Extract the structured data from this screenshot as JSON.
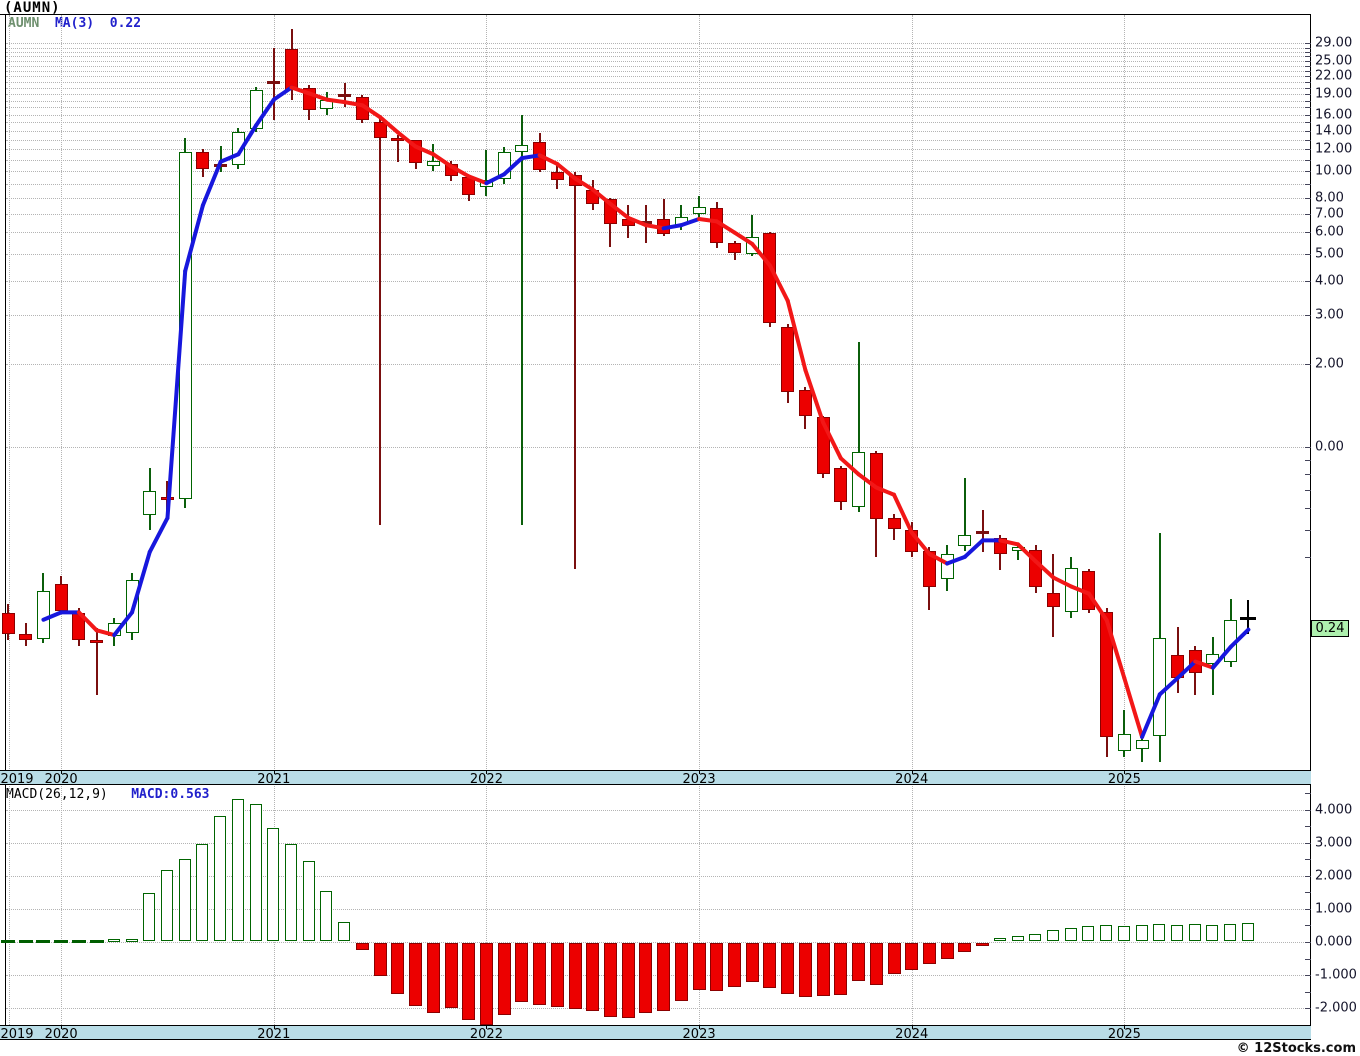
{
  "chart": {
    "title": "(AUMN)",
    "legend": {
      "symbol": "AUMN",
      "ma": "MA(3)",
      "ma_value": "0.22"
    },
    "macd_legend": {
      "label": "MACD(26,12,9)",
      "value": "MACD:0.563"
    },
    "watermark": "© 12Stocks.com",
    "badge": "0.24",
    "x_years": [
      "2019",
      "2020",
      "2021",
      "2022",
      "2023",
      "2024",
      "2025"
    ]
  },
  "colors": {
    "up": "#006400",
    "down_fill": "#ec0000",
    "down_border": "#8b0000",
    "wick_down": "#7a0f0f",
    "wick_up": "#0b5e0b",
    "neutral": "#7a0f0f",
    "ma_up": "#1717dd",
    "ma_down": "#f21717",
    "last": "#000000",
    "band": "#b9dde7",
    "badge_bg": "#aef0ae",
    "grid": "#b4b4b4"
  },
  "chart_data": {
    "type": "candlestick",
    "symbol": "AUMN",
    "interval": "monthly",
    "price_scale": "log",
    "title": "(AUMN)",
    "legend_position": "top-left",
    "grid": true,
    "overlay": {
      "type": "moving_average",
      "period": 3,
      "last_value": 0.22,
      "up_color": "blue",
      "down_color": "red"
    },
    "price_axis_labels": [
      {
        "value": 29,
        "text": "29.00"
      },
      {
        "value": 25,
        "text": "25.00"
      },
      {
        "value": 22,
        "text": "22.00"
      },
      {
        "value": 19,
        "text": "19.00"
      },
      {
        "value": 16,
        "text": "16.00"
      },
      {
        "value": 14,
        "text": "14.00"
      },
      {
        "value": 12,
        "text": "12.00"
      },
      {
        "value": 10,
        "text": "10.00"
      },
      {
        "value": 8,
        "text": "8.00"
      },
      {
        "value": 7,
        "text": "7.00"
      },
      {
        "value": 6,
        "text": "6.00"
      },
      {
        "value": 5,
        "text": "5.00"
      },
      {
        "value": 4,
        "text": "4.00"
      },
      {
        "value": 3,
        "text": "3.00"
      },
      {
        "value": 2,
        "text": "2.00"
      },
      {
        "value": 1,
        "text": "0.00"
      }
    ],
    "last_close": 0.24,
    "candles": [
      {
        "t": "2019-10",
        "o": 0.25,
        "h": 0.27,
        "l": 0.2,
        "c": 0.21
      },
      {
        "t": "2019-11",
        "o": 0.21,
        "h": 0.23,
        "l": 0.19,
        "c": 0.2
      },
      {
        "t": "2019-12",
        "o": 0.2,
        "h": 0.35,
        "l": 0.195,
        "c": 0.3
      },
      {
        "t": "2020-01",
        "o": 0.32,
        "h": 0.34,
        "l": 0.25,
        "c": 0.255
      },
      {
        "t": "2020-02",
        "o": 0.25,
        "h": 0.26,
        "l": 0.19,
        "c": 0.2
      },
      {
        "t": "2020-03",
        "o": 0.2,
        "h": 0.22,
        "l": 0.126,
        "c": 0.195
      },
      {
        "t": "2020-04",
        "o": 0.205,
        "h": 0.24,
        "l": 0.19,
        "c": 0.23
      },
      {
        "t": "2020-05",
        "o": 0.21,
        "h": 0.35,
        "l": 0.2,
        "c": 0.33
      },
      {
        "t": "2020-06",
        "o": 0.56,
        "h": 0.84,
        "l": 0.5,
        "c": 0.69
      },
      {
        "t": "2020-07",
        "o": 0.66,
        "h": 0.75,
        "l": 0.58,
        "c": 0.64
      },
      {
        "t": "2020-08",
        "o": 0.64,
        "h": 13.2,
        "l": 0.6,
        "c": 11.7
      },
      {
        "t": "2020-09",
        "o": 11.7,
        "h": 12.0,
        "l": 9.5,
        "c": 10.2
      },
      {
        "t": "2020-10",
        "o": 10.4,
        "h": 12.3,
        "l": 9.9,
        "c": 10.5
      },
      {
        "t": "2020-11",
        "o": 10.4,
        "h": 14.3,
        "l": 10.2,
        "c": 13.8
      },
      {
        "t": "2020-12",
        "o": 14.1,
        "h": 20.1,
        "l": 13.9,
        "c": 19.6
      },
      {
        "t": "2021-01",
        "o": 21.0,
        "h": 27.9,
        "l": 15.3,
        "c": 21.0
      },
      {
        "t": "2021-02",
        "o": 27.7,
        "h": 32.6,
        "l": 18.1,
        "c": 19.6
      },
      {
        "t": "2021-03",
        "o": 20.0,
        "h": 20.5,
        "l": 15.3,
        "c": 16.7
      },
      {
        "t": "2021-04",
        "o": 16.6,
        "h": 19.3,
        "l": 16.0,
        "c": 18.1
      },
      {
        "t": "2021-05",
        "o": 18.7,
        "h": 20.9,
        "l": 17.0,
        "c": 18.5
      },
      {
        "t": "2021-06",
        "o": 18.5,
        "h": 18.8,
        "l": 14.9,
        "c": 15.3
      },
      {
        "t": "2021-07",
        "o": 15.0,
        "h": 15.5,
        "l": 0.52,
        "c": 13.2
      },
      {
        "t": "2021-08",
        "o": 13.2,
        "h": 13.5,
        "l": 10.8,
        "c": 12.9
      },
      {
        "t": "2021-09",
        "o": 12.9,
        "h": 13.0,
        "l": 10.2,
        "c": 10.7
      },
      {
        "t": "2021-10",
        "o": 10.3,
        "h": 12.5,
        "l": 10.0,
        "c": 10.9
      },
      {
        "t": "2021-11",
        "o": 10.6,
        "h": 10.9,
        "l": 9.2,
        "c": 9.6
      },
      {
        "t": "2021-12",
        "o": 9.5,
        "h": 9.7,
        "l": 7.8,
        "c": 8.2
      },
      {
        "t": "2022-01",
        "o": 8.7,
        "h": 11.9,
        "l": 8.1,
        "c": 9.3
      },
      {
        "t": "2022-02",
        "o": 9.3,
        "h": 12.2,
        "l": 9.0,
        "c": 11.7
      },
      {
        "t": "2022-03",
        "o": 11.6,
        "h": 15.9,
        "l": 0.52,
        "c": 12.4
      },
      {
        "t": "2022-04",
        "o": 12.7,
        "h": 13.7,
        "l": 9.9,
        "c": 10.1
      },
      {
        "t": "2022-05",
        "o": 9.9,
        "h": 10.5,
        "l": 8.6,
        "c": 9.3
      },
      {
        "t": "2022-06",
        "o": 9.7,
        "h": 9.9,
        "l": 0.36,
        "c": 8.8
      },
      {
        "t": "2022-07",
        "o": 8.5,
        "h": 9.3,
        "l": 7.2,
        "c": 7.6
      },
      {
        "t": "2022-08",
        "o": 7.9,
        "h": 8.0,
        "l": 5.3,
        "c": 6.4
      },
      {
        "t": "2022-09",
        "o": 6.7,
        "h": 7.5,
        "l": 5.7,
        "c": 6.3
      },
      {
        "t": "2022-10",
        "o": 6.5,
        "h": 7.5,
        "l": 5.5,
        "c": 6.4
      },
      {
        "t": "2022-11",
        "o": 6.7,
        "h": 7.9,
        "l": 5.8,
        "c": 5.9
      },
      {
        "t": "2022-12",
        "o": 6.3,
        "h": 7.5,
        "l": 6.1,
        "c": 6.8
      },
      {
        "t": "2023-01",
        "o": 6.9,
        "h": 8.1,
        "l": 6.7,
        "c": 7.4
      },
      {
        "t": "2023-02",
        "o": 7.35,
        "h": 7.7,
        "l": 5.25,
        "c": 5.5
      },
      {
        "t": "2023-03",
        "o": 5.5,
        "h": 5.6,
        "l": 4.76,
        "c": 5.05
      },
      {
        "t": "2023-04",
        "o": 4.97,
        "h": 6.9,
        "l": 4.9,
        "c": 5.77
      },
      {
        "t": "2023-05",
        "o": 5.96,
        "h": 6.0,
        "l": 2.73,
        "c": 2.82
      },
      {
        "t": "2023-06",
        "o": 2.73,
        "h": 2.8,
        "l": 1.44,
        "c": 1.58
      },
      {
        "t": "2023-07",
        "o": 1.61,
        "h": 1.65,
        "l": 1.16,
        "c": 1.3
      },
      {
        "t": "2023-08",
        "o": 1.28,
        "h": 1.3,
        "l": 0.77,
        "c": 0.8
      },
      {
        "t": "2023-09",
        "o": 0.84,
        "h": 0.85,
        "l": 0.59,
        "c": 0.63
      },
      {
        "t": "2023-10",
        "o": 0.6,
        "h": 2.4,
        "l": 0.58,
        "c": 0.96
      },
      {
        "t": "2023-11",
        "o": 0.95,
        "h": 0.97,
        "l": 0.4,
        "c": 0.55
      },
      {
        "t": "2023-12",
        "o": 0.553,
        "h": 0.57,
        "l": 0.46,
        "c": 0.504
      },
      {
        "t": "2024-01",
        "o": 0.5,
        "h": 0.535,
        "l": 0.4,
        "c": 0.415
      },
      {
        "t": "2024-02",
        "o": 0.42,
        "h": 0.435,
        "l": 0.256,
        "c": 0.31
      },
      {
        "t": "2024-03",
        "o": 0.33,
        "h": 0.44,
        "l": 0.3,
        "c": 0.41
      },
      {
        "t": "2024-04",
        "o": 0.435,
        "h": 0.77,
        "l": 0.42,
        "c": 0.48
      },
      {
        "t": "2024-05",
        "o": 0.49,
        "h": 0.59,
        "l": 0.415,
        "c": 0.486
      },
      {
        "t": "2024-06",
        "o": 0.47,
        "h": 0.48,
        "l": 0.358,
        "c": 0.41
      },
      {
        "t": "2024-07",
        "o": 0.415,
        "h": 0.45,
        "l": 0.39,
        "c": 0.435
      },
      {
        "t": "2024-08",
        "o": 0.425,
        "h": 0.44,
        "l": 0.295,
        "c": 0.31
      },
      {
        "t": "2024-09",
        "o": 0.295,
        "h": 0.41,
        "l": 0.205,
        "c": 0.264
      },
      {
        "t": "2024-10",
        "o": 0.25,
        "h": 0.4,
        "l": 0.24,
        "c": 0.363
      },
      {
        "t": "2024-11",
        "o": 0.355,
        "h": 0.36,
        "l": 0.25,
        "c": 0.256
      },
      {
        "t": "2024-12",
        "o": 0.252,
        "h": 0.26,
        "l": 0.075,
        "c": 0.089
      },
      {
        "t": "2025-01",
        "o": 0.0785,
        "h": 0.111,
        "l": 0.075,
        "c": 0.091
      },
      {
        "t": "2025-02",
        "o": 0.08,
        "h": 0.09,
        "l": 0.072,
        "c": 0.087
      },
      {
        "t": "2025-03",
        "o": 0.089,
        "h": 0.486,
        "l": 0.072,
        "c": 0.203
      },
      {
        "t": "2025-04",
        "o": 0.176,
        "h": 0.223,
        "l": 0.128,
        "c": 0.146
      },
      {
        "t": "2025-05",
        "o": 0.184,
        "h": 0.19,
        "l": 0.126,
        "c": 0.152
      },
      {
        "t": "2025-06",
        "o": 0.162,
        "h": 0.205,
        "l": 0.126,
        "c": 0.178
      },
      {
        "t": "2025-07",
        "o": 0.165,
        "h": 0.282,
        "l": 0.16,
        "c": 0.236
      },
      {
        "t": "2025-08",
        "o": 0.24,
        "h": 0.28,
        "l": 0.21,
        "c": 0.24,
        "last": true
      }
    ],
    "indicator": {
      "type": "macd",
      "params": [
        26,
        12,
        9
      ],
      "last_value": 0.563,
      "axis_labels": [
        {
          "value": 4,
          "text": "4.000"
        },
        {
          "value": 3,
          "text": "3.000"
        },
        {
          "value": 2,
          "text": "2.000"
        },
        {
          "value": 1,
          "text": "1.000"
        },
        {
          "value": 0,
          "text": "0.000"
        },
        {
          "value": -1,
          "text": "-1.000"
        },
        {
          "value": -2,
          "text": "-2.000"
        }
      ],
      "histogram": [
        0.01,
        0.01,
        0.02,
        0.02,
        0.01,
        0.01,
        0.08,
        0.08,
        1.49,
        2.18,
        2.5,
        2.96,
        3.8,
        4.32,
        4.16,
        3.43,
        2.96,
        2.46,
        1.55,
        0.59,
        -0.22,
        -1.01,
        -1.53,
        -1.91,
        -2.1,
        -1.95,
        -2.34,
        -2.54,
        -2.18,
        -1.77,
        -1.86,
        -1.93,
        -2.0,
        -2.05,
        -2.23,
        -2.27,
        -2.12,
        -2.06,
        -1.74,
        -1.42,
        -1.44,
        -1.34,
        -1.19,
        -1.36,
        -1.54,
        -1.62,
        -1.59,
        -1.56,
        -1.14,
        -1.26,
        -0.94,
        -0.82,
        -0.64,
        -0.49,
        -0.27,
        -0.07,
        0.11,
        0.19,
        0.24,
        0.36,
        0.43,
        0.49,
        0.51,
        0.49,
        0.51,
        0.53,
        0.51,
        0.53,
        0.51,
        0.53,
        0.563
      ]
    }
  }
}
